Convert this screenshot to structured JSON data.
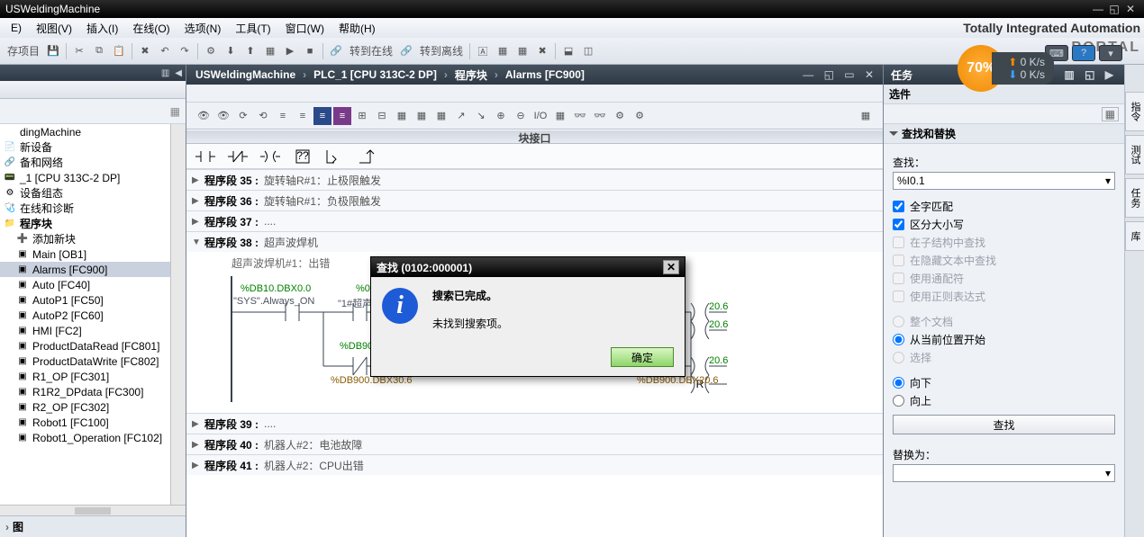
{
  "title": "USWeldingMachine",
  "menu": [
    "E)",
    "视图(V)",
    "插入(I)",
    "在线(O)",
    "选项(N)",
    "工具(T)",
    "窗口(W)",
    "帮助(H)"
  ],
  "brand1": "Totally Integrated Automation",
  "brand2": "PORTAL",
  "toolbar_project_label": "存项目",
  "tb_gobtn1": "转到在线",
  "tb_gobtn2": "转到离线",
  "crumbs": [
    "USWeldingMachine",
    "PLC_1 [CPU 313C-2 DP]",
    "程序块",
    "Alarms [FC900]"
  ],
  "blockif": "块接口",
  "tree": {
    "items": [
      {
        "t": "dingMachine",
        "ind": 0
      },
      {
        "t": "新设备",
        "ind": 0,
        "pre": "📄"
      },
      {
        "t": "备和网络",
        "ind": 0,
        "pre": "🔗"
      },
      {
        "t": "_1 [CPU 313C-2 DP]",
        "ind": 0,
        "pre": "📟"
      },
      {
        "t": "设备组态",
        "ind": 0,
        "pre": "⚙"
      },
      {
        "t": "在线和诊断",
        "ind": 0,
        "pre": "🩺"
      },
      {
        "t": "程序块",
        "ind": 0,
        "pre": "📁",
        "bold": true
      },
      {
        "t": "添加新块",
        "ind": 1,
        "pre": "➕"
      },
      {
        "t": "Main [OB1]",
        "ind": 1,
        "pre": "▣"
      },
      {
        "t": "Alarms [FC900]",
        "ind": 1,
        "pre": "▣",
        "sel": true
      },
      {
        "t": "Auto [FC40]",
        "ind": 1,
        "pre": "▣"
      },
      {
        "t": "AutoP1 [FC50]",
        "ind": 1,
        "pre": "▣"
      },
      {
        "t": "AutoP2 [FC60]",
        "ind": 1,
        "pre": "▣"
      },
      {
        "t": "HMI [FC2]",
        "ind": 1,
        "pre": "▣"
      },
      {
        "t": "ProductDataRead [FC801]",
        "ind": 1,
        "pre": "▣"
      },
      {
        "t": "ProductDataWrite [FC802]",
        "ind": 1,
        "pre": "▣"
      },
      {
        "t": "R1_OP [FC301]",
        "ind": 1,
        "pre": "▣"
      },
      {
        "t": "R1R2_DPdata [FC300]",
        "ind": 1,
        "pre": "▣"
      },
      {
        "t": "R2_OP [FC302]",
        "ind": 1,
        "pre": "▣"
      },
      {
        "t": "Robot1 [FC100]",
        "ind": 1,
        "pre": "▣"
      },
      {
        "t": "Robot1_Operation [FC102]",
        "ind": 1,
        "pre": "▣"
      }
    ],
    "footer": "图"
  },
  "segments": [
    {
      "n": "程序段 35 :",
      "title": "旋转轴R#1：止极限触发",
      "open": false
    },
    {
      "n": "程序段 36 :",
      "title": "旋转轴R#1：负极限触发",
      "open": false
    },
    {
      "n": "程序段 37 :",
      "title": "....",
      "open": false
    },
    {
      "n": "程序段 38 :",
      "title": "超声波焊机",
      "open": true,
      "comment": "超声波焊机#1：出错",
      "labels": {
        "l1": "%DB10.DBX0.0",
        "l1b": "\"SYS\".Always_ON",
        "l2": "%0",
        "l2b": "\"1#超声",
        "l3": "%DB900.I",
        "l4": "%DB900.DBX30.6",
        "l5": "20.6",
        "l6": "20.6",
        "l7": "20.6",
        "l8": "%DB900.DBX20.6",
        "r": "R"
      }
    },
    {
      "n": "程序段 39 :",
      "title": "....",
      "open": false
    },
    {
      "n": "程序段 40 :",
      "title": "机器人#2：电池故障",
      "open": false
    },
    {
      "n": "程序段 41 :",
      "title": "机器人#2：CPU出错",
      "open": false
    }
  ],
  "right": {
    "title": "任务",
    "sec1": "选件",
    "sec2": "查找和替换",
    "find_label": "查找：",
    "find_value": "%I0.1",
    "cb1": "全字匹配",
    "cb2": "区分大小写",
    "cb3": "在子结构中查找",
    "cb4": "在隐藏文本中查找",
    "cb5": "使用通配符",
    "cb6": "使用正则表达式",
    "rb1": "整个文档",
    "rb2": "从当前位置开始",
    "rb3": "选择",
    "rb4": "向下",
    "rb5": "向上",
    "btn": "查找",
    "rep_label": "替换为："
  },
  "modal": {
    "title": "查找 (0102:000001)",
    "line1": "搜索已完成。",
    "line2": "未找到搜索项。",
    "ok": "确定"
  },
  "gauge": {
    "pct": "70%",
    "up": "0 K/s",
    "dn": "0 K/s"
  },
  "vtabs": [
    "指令",
    "测试",
    "任务",
    "库"
  ]
}
